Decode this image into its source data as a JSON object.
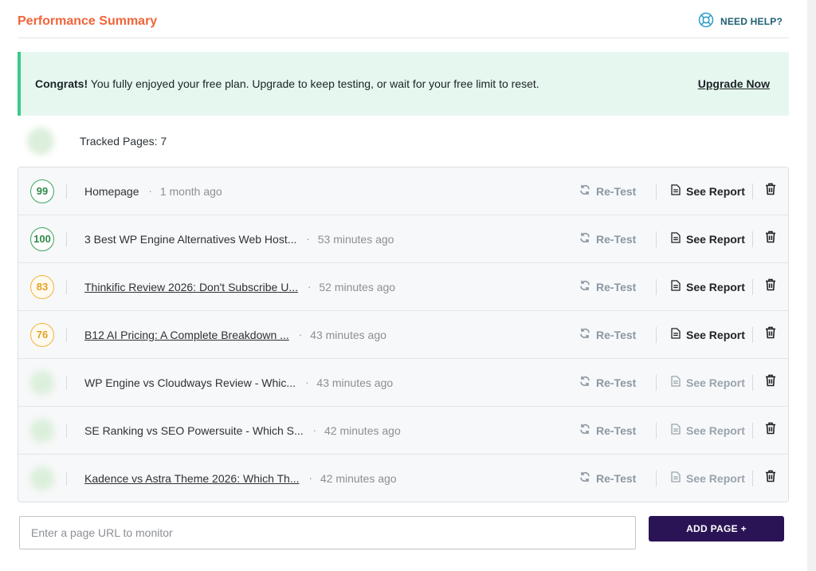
{
  "header": {
    "title": "Performance Summary",
    "help_label": "NEED HELP?"
  },
  "notice": {
    "bold": "Congrats!",
    "message": " You fully enjoyed your free plan. Upgrade to keep testing, or wait for your free limit to reset.",
    "link": "Upgrade Now"
  },
  "tracked": {
    "label": "Tracked Pages: 7"
  },
  "actions": {
    "retest_label": "Re-Test",
    "report_label": "See Report",
    "separator": "·"
  },
  "rows": [
    {
      "score": "99",
      "score_state": "good",
      "title": "Homepage",
      "time": "1 month ago",
      "report_enabled": true
    },
    {
      "score": "100",
      "score_state": "good",
      "title": "3 Best WP Engine Alternatives Web Host...",
      "time": "53 minutes ago",
      "report_enabled": true
    },
    {
      "score": "83",
      "score_state": "warn",
      "title": "Thinkific Review 2026: Don't Subscribe U...",
      "time": "52 minutes ago",
      "report_enabled": true
    },
    {
      "score": "76",
      "score_state": "warn",
      "title": "B12 AI Pricing: A Complete Breakdown ...",
      "time": "43 minutes ago",
      "report_enabled": true
    },
    {
      "score": "",
      "score_state": "pending",
      "title": "WP Engine vs Cloudways Review - Whic...",
      "time": "43 minutes ago",
      "report_enabled": false
    },
    {
      "score": "",
      "score_state": "pending",
      "title": "SE Ranking vs SEO Powersuite - Which S...",
      "time": "42 minutes ago",
      "report_enabled": false
    },
    {
      "score": "",
      "score_state": "pending",
      "title": "Kadence vs Astra Theme 2026: Which Th...",
      "time": "42 minutes ago",
      "report_enabled": false
    }
  ],
  "add_page": {
    "placeholder": "Enter a page URL to monitor",
    "button_label": "ADD PAGE +"
  },
  "colors": {
    "title": "#f0643a",
    "notice_bg": "#e6f7ef",
    "notice_border": "#3cc88a",
    "good": "#3aa55a",
    "warn": "#f0b43c",
    "primary_button": "#2a1455"
  }
}
